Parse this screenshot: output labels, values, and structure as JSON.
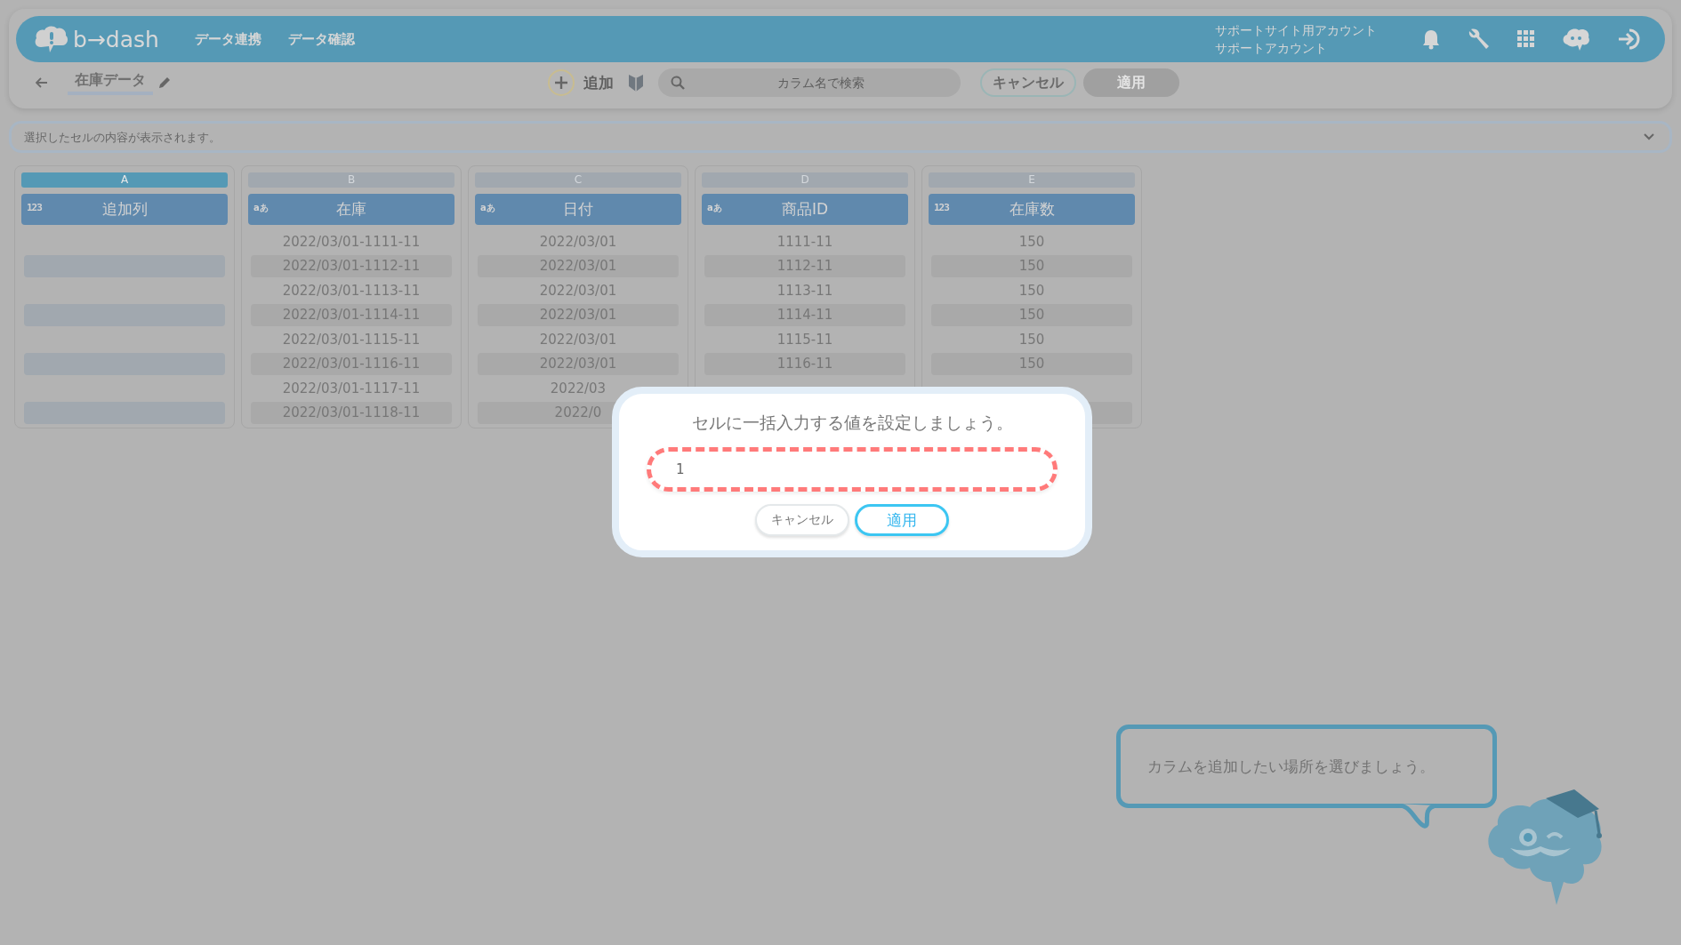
{
  "header": {
    "logo": "b→dash",
    "nav": [
      "データ連携",
      "データ確認"
    ],
    "account": {
      "line_1": "サポートサイト用アカウント",
      "line_2": "サポートアカウント"
    }
  },
  "toolbar": {
    "title": "在庫データ",
    "add_label": "追加",
    "search": {
      "placeholder": "カラム名で検索"
    },
    "buttons": [
      {
        "label": "キャンセル",
        "disabled": false
      },
      {
        "label": "適用",
        "disabled": true
      }
    ]
  },
  "cell_info": {
    "placeholder": "選択したセルの内容が表示されます。"
  },
  "columns": [
    {
      "letter": "A",
      "selected": true,
      "type_badge": "123",
      "name": "追加列",
      "kind": "number"
    },
    {
      "letter": "B",
      "selected": false,
      "type_badge": "aあ",
      "name": "在庫",
      "kind": "text",
      "cells": [
        "2022/03/01-1111-11",
        "2022/03/01-1112-11",
        "2022/03/01-1113-11",
        "2022/03/01-1114-11",
        "2022/03/01-1115-11",
        "2022/03/01-1116-11",
        "2022/03/01-1117-11",
        "2022/03/01-1118-11"
      ]
    },
    {
      "letter": "C",
      "selected": false,
      "type_badge": "aあ",
      "name": "日付",
      "kind": "text",
      "cells": [
        "2022/03/01",
        "2022/03/01",
        "2022/03/01",
        "2022/03/01",
        "2022/03/01",
        "2022/03/01",
        "2022/03",
        "2022/0"
      ]
    },
    {
      "letter": "D",
      "selected": false,
      "type_badge": "aあ",
      "name": "商品ID",
      "kind": "text",
      "cells": [
        "1111-11",
        "1112-11",
        "1113-11",
        "1114-11",
        "1115-11",
        "1116-11"
      ]
    },
    {
      "letter": "E",
      "selected": false,
      "type_badge": "123",
      "name": "在庫数",
      "kind": "number",
      "cells": [
        "150",
        "150",
        "150",
        "150",
        "150",
        "150"
      ]
    }
  ],
  "dialog": {
    "title": "セルに一括入力する値を設定しましょう。",
    "value": "1",
    "highlighted": true,
    "buttons": [
      {
        "label": "キャンセル",
        "primary": false
      },
      {
        "label": "適用",
        "primary": true
      }
    ]
  },
  "guide": {
    "message": "カラムを追加したい場所を選びましょう。"
  }
}
